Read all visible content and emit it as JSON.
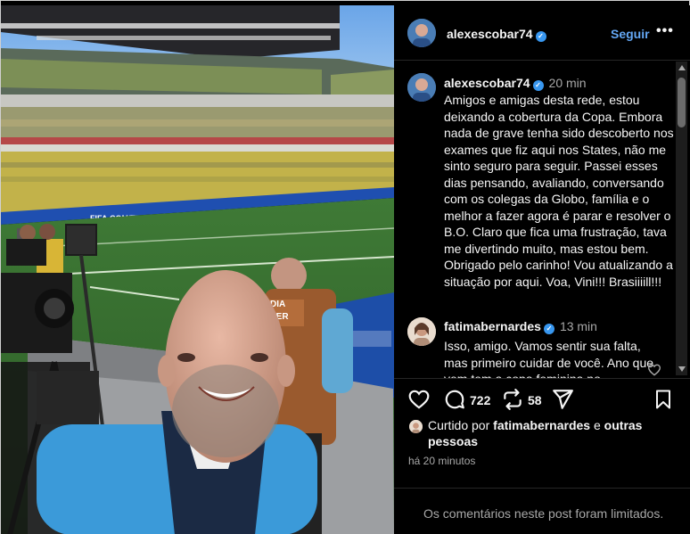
{
  "post": {
    "author": {
      "username": "alexescobar74",
      "verified_icon": "verified-badge-icon"
    },
    "follow_label": "Seguir",
    "more_label": "•••",
    "caption": {
      "username": "alexescobar74",
      "time": "20 min",
      "text": "Amigos e amigas desta rede, estou deixando a cobertura da Copa. Embora nada de grave tenha sido descoberto nos exames que fiz aqui nos States, não me sinto seguro para seguir. Passei esses dias pensando, avaliando, conversando com os colegas da Globo, família e o melhor a fazer agora é parar e resolver o B.O. Claro que fica uma frustração, tava me divertindo muito, mas estou bem. Obrigado pelo carinho! Vou atualizando a situação por aqui. Voa, Vini!!! Brasiiiill!!!"
    },
    "comments": [
      {
        "username": "fatimabernardes",
        "verified_icon": "verified-badge-icon",
        "time": "13 min",
        "text": "Isso, amigo. Vamos sentir sua falta, mas primeiro cuidar de você. Ano que vem tem a copa feminina no"
      }
    ],
    "actions": {
      "comment_count": "722",
      "repost_count": "58"
    },
    "liked_by": {
      "prefix": "Curtido por ",
      "user": "fatimabernardes",
      "middle": " e ",
      "others": "outras pessoas"
    },
    "posted_ago": "há 20 minutos",
    "comments_limited": "Os comentários neste post foram limitados."
  },
  "colors": {
    "background": "#000000",
    "text": "#f5f5f5",
    "muted": "#a8a8a8",
    "link_blue": "#64a8f5",
    "verified_blue": "#3897f0",
    "divider": "#262626"
  }
}
